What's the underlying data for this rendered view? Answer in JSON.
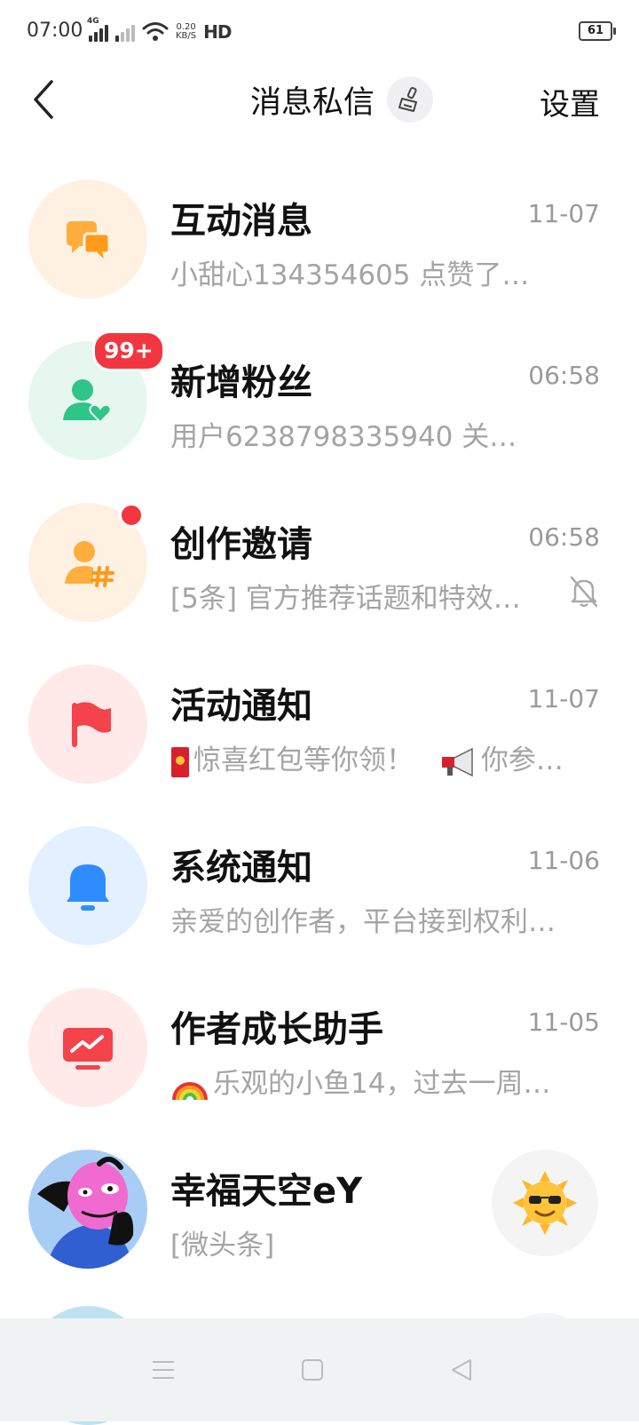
{
  "status_bar": {
    "time": "07:00",
    "network_tag": "4G",
    "net_speed_value": "0.20",
    "net_speed_unit": "KB/S",
    "hd_label": "HD",
    "battery": "61"
  },
  "header": {
    "title": "消息私信",
    "settings_label": "设置",
    "back_icon": "chevron-left-icon",
    "clear_icon": "broom-icon"
  },
  "messages": [
    {
      "title": "互动消息",
      "time": "11-07",
      "preview": "小甜心134354605 点赞了…",
      "icon": "chat-bubbles-icon",
      "bg": "#fff1e2",
      "accent": "#ffae3d"
    },
    {
      "title": "新增粉丝",
      "time": "06:58",
      "preview": "用户6238798335940 关…",
      "badge": "99+",
      "icon": "user-heart-icon",
      "bg": "#e5f7ef",
      "accent": "#2fc48a"
    },
    {
      "title": "创作邀请",
      "time": "06:58",
      "preview": "[5条] 官方推荐话题和特效…",
      "icon": "user-hashtag-icon",
      "bg": "#fff1e2",
      "accent": "#ffae3d",
      "muted": true
    },
    {
      "title": "活动通知",
      "time": "11-07",
      "preview": "惊喜红包等你领！",
      "preview2": "你参…",
      "icon": "flag-icon",
      "bg": "#ffe9e9",
      "accent": "#f5434b"
    },
    {
      "title": "系统通知",
      "time": "11-06",
      "preview": "亲爱的创作者，平台接到权利…",
      "icon": "bell-icon",
      "bg": "#e3f0ff",
      "accent": "#2f8cff"
    },
    {
      "title": "作者成长助手",
      "time": "11-05",
      "preview": "乐观的小鱼14，过去一周…",
      "icon": "chart-monitor-icon",
      "bg": "#ffe9e9",
      "accent": "#f5434b"
    },
    {
      "title": "幸福天空eY",
      "time": "",
      "preview": "[微头条]",
      "icon": "user-avatar",
      "bg": "#a8cdf5",
      "accent": "#2f5fd0"
    }
  ],
  "colors": {
    "badge_red": "#f2363f",
    "title_text": "#111111",
    "secondary_text": "#9a9a9a"
  }
}
